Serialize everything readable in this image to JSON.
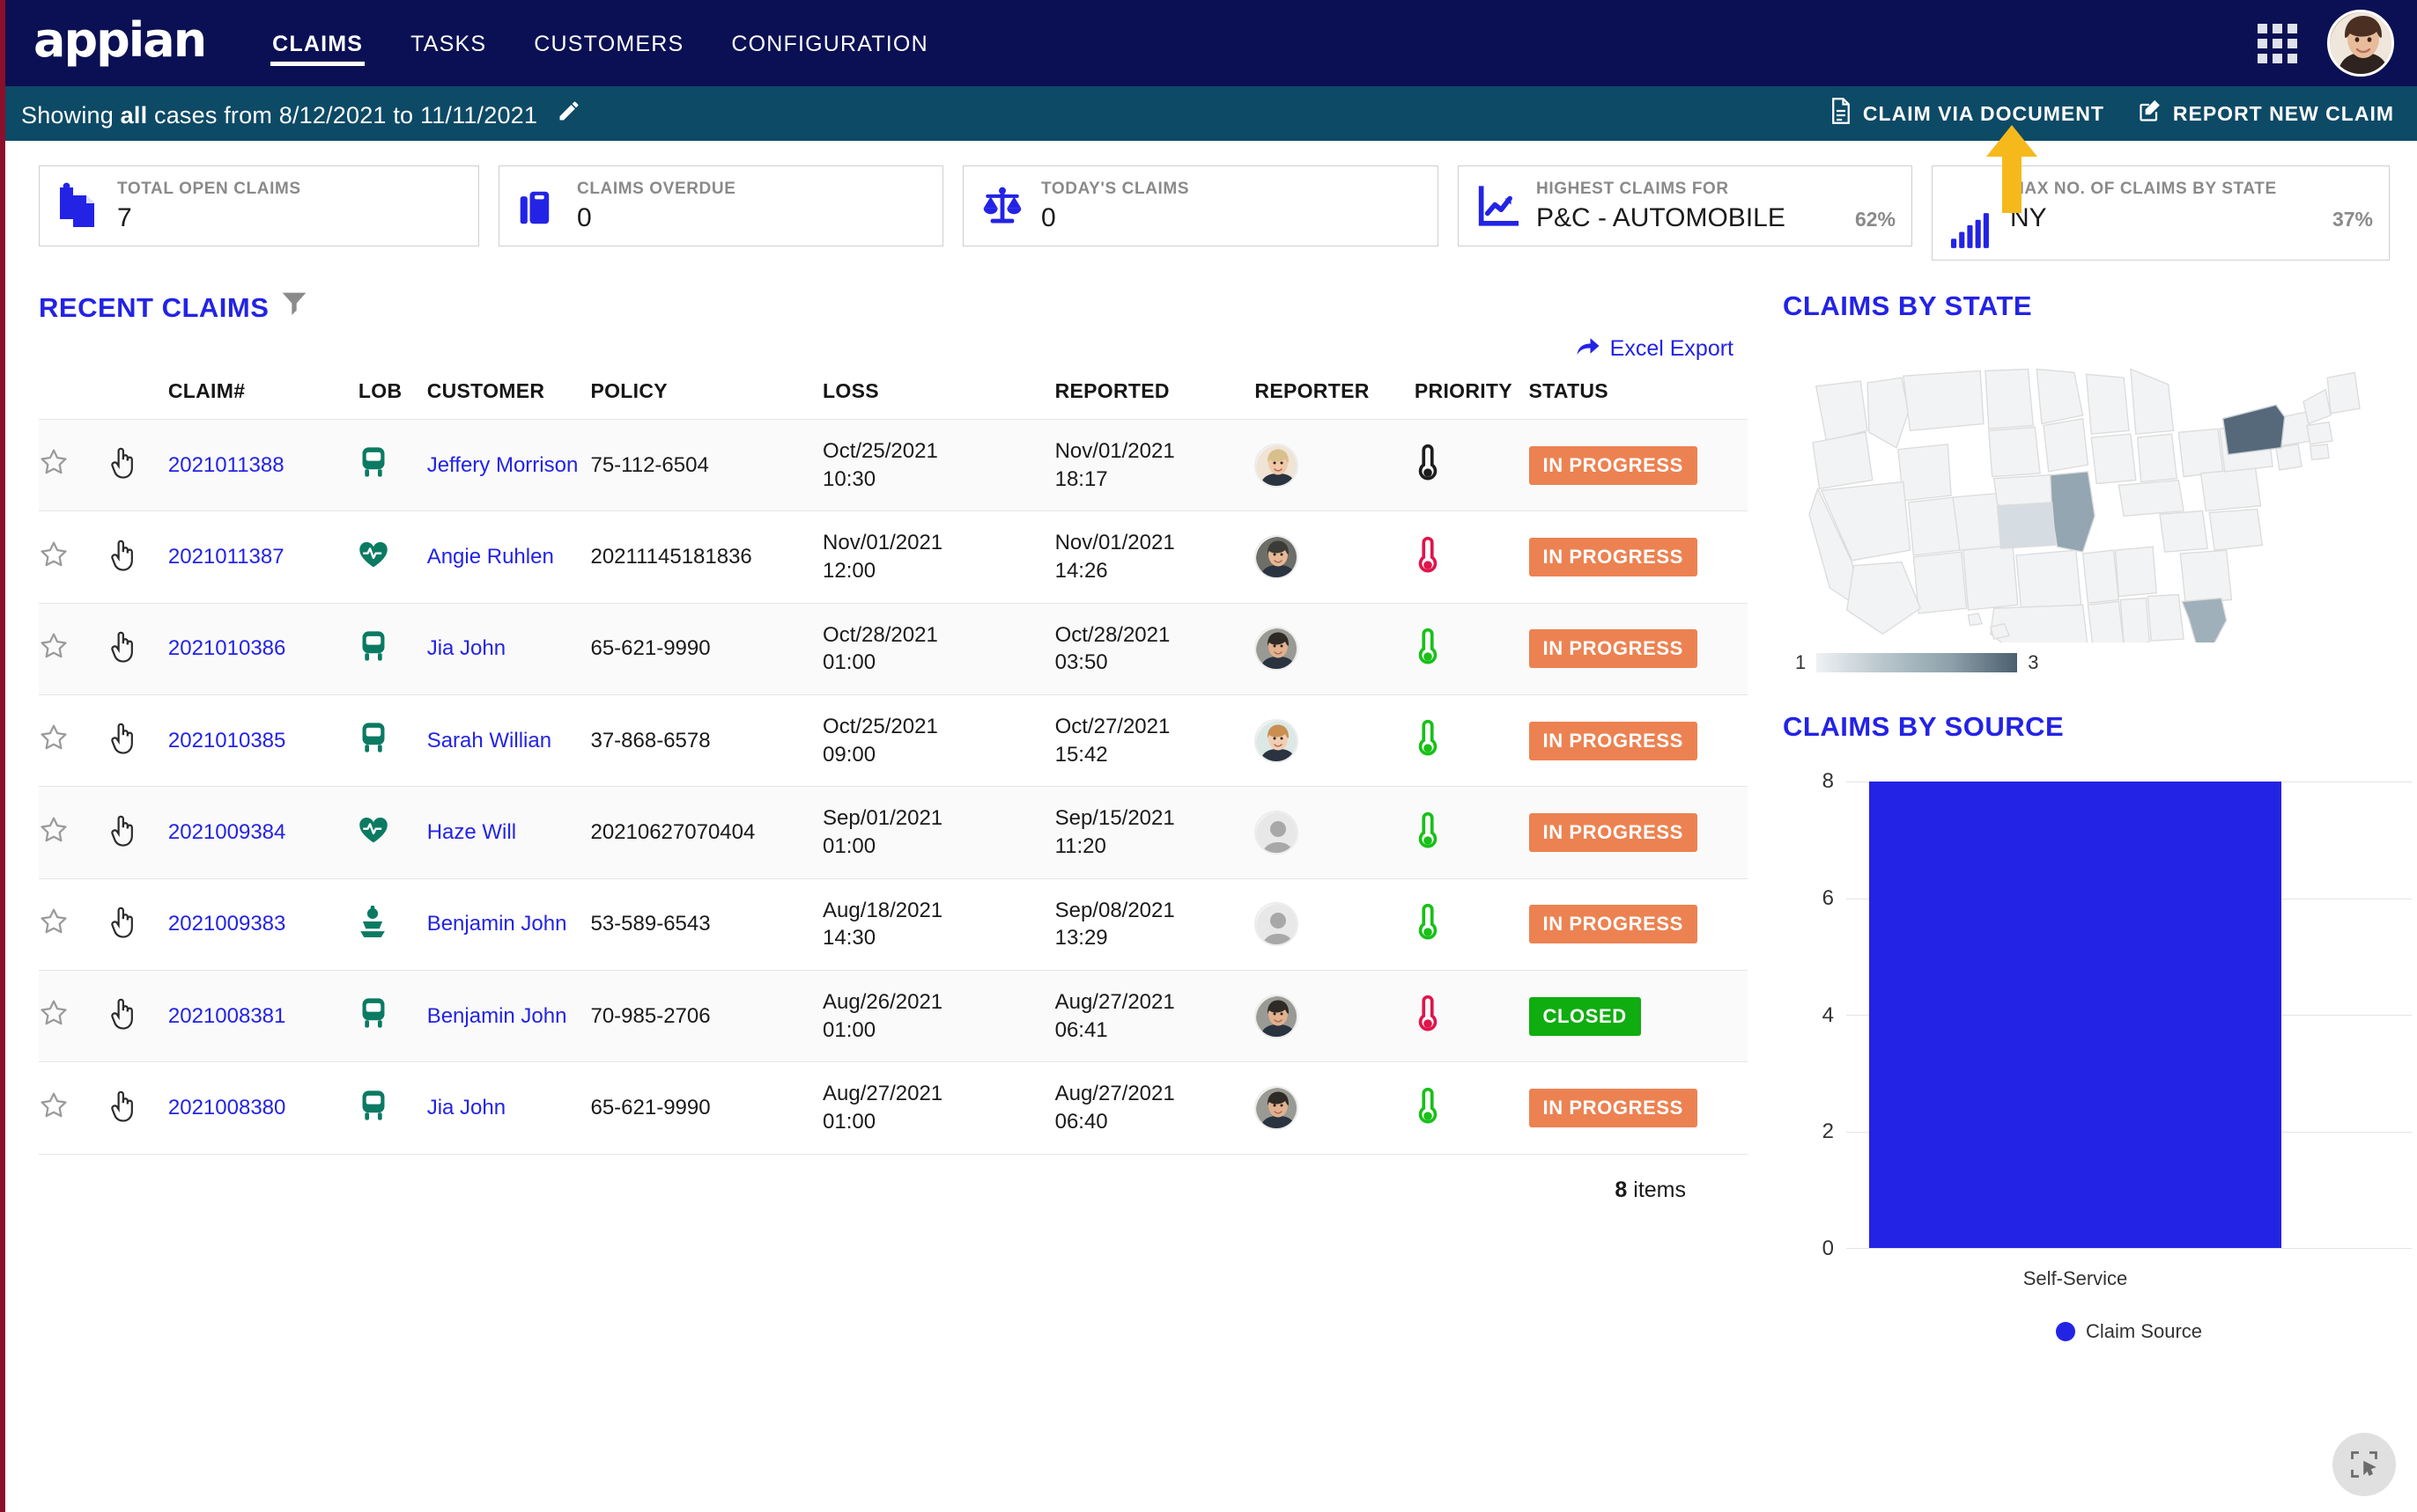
{
  "brand": {
    "logo_text": "appian",
    "navy": "#0b1054",
    "teal": "#0d4a66",
    "accent_blue": "#2323e6",
    "left_accent": "#8b0f2b"
  },
  "topnav": {
    "links": [
      {
        "label": "CLAIMS",
        "active": true
      },
      {
        "label": "TASKS",
        "active": false
      },
      {
        "label": "CUSTOMERS",
        "active": false
      },
      {
        "label": "CONFIGURATION",
        "active": false
      }
    ],
    "apps_icon": "grid-apps-icon",
    "avatar": "user-avatar"
  },
  "subbar": {
    "prefix": "Showing ",
    "scope": "all",
    "middle": " cases from ",
    "date_from": "8/12/2021",
    "to_word": " to ",
    "date_to": "11/11/2021",
    "edit_icon": "pencil-icon",
    "actions": [
      {
        "label": "CLAIM VIA DOCUMENT",
        "icon": "document-icon"
      },
      {
        "label": "REPORT NEW CLAIM",
        "icon": "edit-square-icon"
      }
    ]
  },
  "kpis": [
    {
      "label": "TOTAL OPEN CLAIMS",
      "value": "7",
      "pct": "",
      "icon": "clipboard-copy-icon"
    },
    {
      "label": "CLAIMS OVERDUE",
      "value": "0",
      "pct": "",
      "icon": "briefcase-icon"
    },
    {
      "label": "TODAY'S CLAIMS",
      "value": "0",
      "pct": "",
      "icon": "scales-icon"
    },
    {
      "label": "HIGHEST CLAIMS FOR",
      "value": "P&C - AUTOMOBILE",
      "pct": "62%",
      "icon": "line-chart-icon"
    },
    {
      "label": "MAX NO. OF CLAIMS BY STATE",
      "value": "NY",
      "pct": "37%",
      "icon": "bar-chart-icon"
    }
  ],
  "recent_claims": {
    "title": "RECENT CLAIMS",
    "filter_icon": "funnel-filter-icon",
    "export_label": "Excel Export",
    "export_icon": "share-arrow-icon",
    "columns": [
      "",
      "",
      "CLAIM#",
      "LOB",
      "CUSTOMER",
      "POLICY",
      "LOSS",
      "REPORTED",
      "REPORTER",
      "PRIORITY",
      "STATUS"
    ],
    "rows": [
      {
        "claim": "2021011388",
        "lob": "auto",
        "customer": "Jeffery Morrison",
        "policy": "75-112-6504",
        "loss_date": "Oct/25/2021",
        "loss_time": "10:30",
        "rep_date": "Nov/01/2021",
        "rep_time": "18:17",
        "reporter": "avatar-woman-blonde",
        "priority": "black",
        "status": "IN PROGRESS",
        "status_kind": "inprogress"
      },
      {
        "claim": "2021011387",
        "lob": "health",
        "customer": "Angie Ruhlen",
        "policy": "20211145181836",
        "loss_date": "Nov/01/2021",
        "loss_time": "12:00",
        "rep_date": "Nov/01/2021",
        "rep_time": "14:26",
        "reporter": "avatar-man-gray",
        "priority": "red",
        "status": "IN PROGRESS",
        "status_kind": "inprogress"
      },
      {
        "claim": "2021010386",
        "lob": "auto",
        "customer": "Jia John",
        "policy": "65-621-9990",
        "loss_date": "Oct/28/2021",
        "loss_time": "01:00",
        "rep_date": "Oct/28/2021",
        "rep_time": "03:50",
        "reporter": "avatar-man-dark",
        "priority": "green",
        "status": "IN PROGRESS",
        "status_kind": "inprogress"
      },
      {
        "claim": "2021010385",
        "lob": "auto",
        "customer": "Sarah Willian",
        "policy": "37-868-6578",
        "loss_date": "Oct/25/2021",
        "loss_time": "09:00",
        "rep_date": "Oct/27/2021",
        "rep_time": "15:42",
        "reporter": "avatar-woman-curly",
        "priority": "green",
        "status": "IN PROGRESS",
        "status_kind": "inprogress"
      },
      {
        "claim": "2021009384",
        "lob": "health",
        "customer": "Haze Will",
        "policy": "20210627070404",
        "loss_date": "Sep/01/2021",
        "loss_time": "01:00",
        "rep_date": "Sep/15/2021",
        "rep_time": "11:20",
        "reporter": "avatar-placeholder",
        "priority": "green",
        "status": "IN PROGRESS",
        "status_kind": "inprogress"
      },
      {
        "claim": "2021009383",
        "lob": "marine",
        "customer": "Benjamin John",
        "policy": "53-589-6543",
        "loss_date": "Aug/18/2021",
        "loss_time": "14:30",
        "rep_date": "Sep/08/2021",
        "rep_time": "13:29",
        "reporter": "avatar-placeholder",
        "priority": "green",
        "status": "IN PROGRESS",
        "status_kind": "inprogress"
      },
      {
        "claim": "2021008381",
        "lob": "auto",
        "customer": "Benjamin John",
        "policy": "70-985-2706",
        "loss_date": "Aug/26/2021",
        "loss_time": "01:00",
        "rep_date": "Aug/27/2021",
        "rep_time": "06:41",
        "reporter": "avatar-man-dark",
        "priority": "red",
        "status": "CLOSED",
        "status_kind": "closed"
      },
      {
        "claim": "2021008380",
        "lob": "auto",
        "customer": "Jia John",
        "policy": "65-621-9990",
        "loss_date": "Aug/27/2021",
        "loss_time": "01:00",
        "rep_date": "Aug/27/2021",
        "rep_time": "06:40",
        "reporter": "avatar-man-dark",
        "priority": "green",
        "status": "IN PROGRESS",
        "status_kind": "inprogress"
      }
    ],
    "items_count": "8",
    "items_word": " items"
  },
  "claims_by_state": {
    "title": "CLAIMS BY STATE",
    "legend_min": "1",
    "legend_max": "3",
    "states": [
      {
        "code": "NY",
        "value": 3
      },
      {
        "code": "MO",
        "value": 2
      },
      {
        "code": "FL",
        "value": 2
      },
      {
        "code": "KS",
        "value": 1
      }
    ]
  },
  "chart_data": {
    "type": "bar",
    "title": "CLAIMS BY SOURCE",
    "categories": [
      "Self-Service"
    ],
    "values": [
      8
    ],
    "series": [
      {
        "name": "Claim Source",
        "values": [
          8
        ]
      }
    ],
    "xlabel": "",
    "ylabel": "",
    "ylim": [
      0,
      8
    ],
    "yticks": [
      0,
      2,
      4,
      6,
      8
    ],
    "grid": true,
    "legend_position": "bottom",
    "bar_color": "#2323e6"
  },
  "fab": {
    "icon": "select-region-cursor-icon"
  }
}
